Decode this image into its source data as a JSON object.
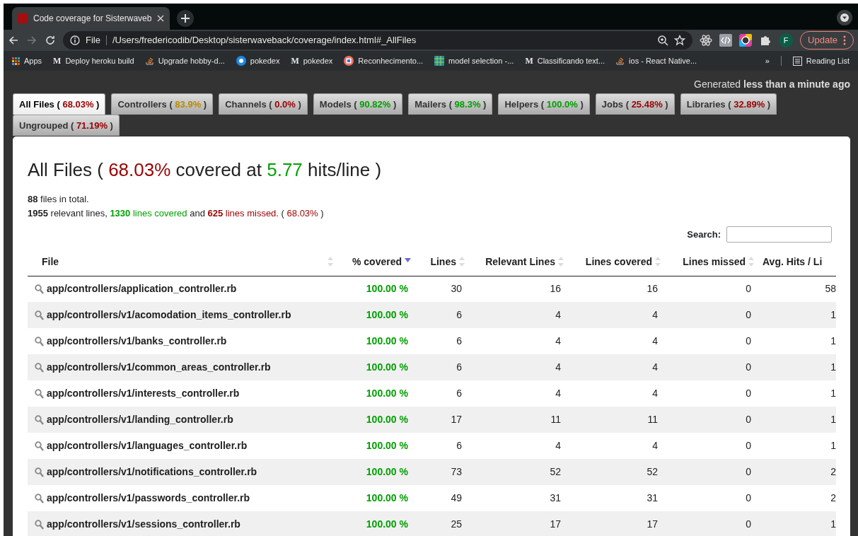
{
  "browser": {
    "tab_title": "Code coverage for Sisterwaveb",
    "url_scheme": "File",
    "url": "/Users/fredericodib/Desktop/sisterwaveback/coverage/index.html#_AllFiles",
    "profile": "F",
    "update_button": "Update",
    "bookmarks": [
      {
        "label": "Apps",
        "kind": "apps"
      },
      {
        "label": "Deploy heroku build",
        "kind": "letter",
        "logo": "M"
      },
      {
        "label": "Upgrade hobby-d...",
        "kind": "stack"
      },
      {
        "label": "pokedex",
        "kind": "circle"
      },
      {
        "label": "pokedex",
        "kind": "letter",
        "logo": "M"
      },
      {
        "label": "Reconhecimento...",
        "kind": "badge"
      },
      {
        "label": "model selection -...",
        "kind": "grid"
      },
      {
        "label": "Classificando text...",
        "kind": "letter",
        "logo": "M"
      },
      {
        "label": "ios - React Native...",
        "kind": "stack"
      }
    ],
    "more_bookmarks": "»",
    "reading_list": "Reading List"
  },
  "generated": {
    "prefix": "Generated",
    "value": "less than a minute ago"
  },
  "groups": [
    {
      "name": "All Files (",
      "percent": "68.03%",
      "close": ")",
      "color": "#990000",
      "selected": true
    },
    {
      "name": "Controllers (",
      "percent": "83.9%",
      "close": ")",
      "color": "#b88a00",
      "selected": false
    },
    {
      "name": "Channels (",
      "percent": "0.0%",
      "close": ")",
      "color": "#990000",
      "selected": false
    },
    {
      "name": "Models (",
      "percent": "90.82%",
      "close": ")",
      "color": "#00a000",
      "selected": false
    },
    {
      "name": "Mailers (",
      "percent": "98.3%",
      "close": ")",
      "color": "#00a000",
      "selected": false
    },
    {
      "name": "Helpers (",
      "percent": "100.0%",
      "close": ")",
      "color": "#00a000",
      "selected": false
    },
    {
      "name": "Jobs (",
      "percent": "25.48%",
      "close": ")",
      "color": "#990000",
      "selected": false
    },
    {
      "name": "Libraries (",
      "percent": "32.89%",
      "close": ")",
      "color": "#990000",
      "selected": false
    },
    {
      "name": "Ungrouped (",
      "percent": "71.19%",
      "close": ")",
      "color": "#990000",
      "selected": false
    }
  ],
  "heading": [
    {
      "text": "All Files (",
      "bold": false
    },
    {
      "text": "68.03%",
      "color": "#990000",
      "bold": false
    },
    {
      "text": "covered at",
      "bold": false
    },
    {
      "text": "5.77",
      "color": "#00a000",
      "bold": false
    },
    {
      "text": "hits/line )",
      "bold": false
    }
  ],
  "files_total": "**88** files in total.",
  "summary": [
    {
      "text": "1955",
      "bold": true
    },
    {
      "text": "relevant lines,",
      "bold": false
    },
    {
      "text": "1330",
      "color": "#00a000",
      "bold": true
    },
    {
      "text": "lines covered",
      "color": "#00a000",
      "bold": false
    },
    {
      "text": "and",
      "bold": false
    },
    {
      "text": "625",
      "color": "#990000",
      "bold": true
    },
    {
      "text": "lines missed.",
      "color": "#990000",
      "bold": false
    },
    {
      "text": "(",
      "bold": false
    },
    {
      "text": "68.03%",
      "color": "#990000",
      "bold": false
    },
    {
      "text": ")",
      "bold": false
    }
  ],
  "search_label": "Search:",
  "table": {
    "columns": [
      {
        "label": "File",
        "kind": "sortable",
        "sorted": false
      },
      {
        "label": "% covered",
        "kind": "sortable",
        "sorted": true
      },
      {
        "label": "Lines",
        "kind": "sortable",
        "sorted": false
      },
      {
        "label": "Relevant Lines",
        "kind": "sortable",
        "sorted": false
      },
      {
        "label": "Lines covered",
        "kind": "sortable",
        "sorted": false
      },
      {
        "label": "Lines missed",
        "kind": "sortable",
        "sorted": false
      },
      {
        "label": "Avg. Hits / Li",
        "kind": "plain"
      }
    ],
    "rows": [
      [
        "app/controllers/application_controller.rb",
        "100.00 %",
        "30",
        "16",
        "16",
        "0",
        "58"
      ],
      [
        "app/controllers/v1/acomodation_items_controller.rb",
        "100.00 %",
        "6",
        "4",
        "4",
        "0",
        "1"
      ],
      [
        "app/controllers/v1/banks_controller.rb",
        "100.00 %",
        "6",
        "4",
        "4",
        "0",
        "1"
      ],
      [
        "app/controllers/v1/common_areas_controller.rb",
        "100.00 %",
        "6",
        "4",
        "4",
        "0",
        "1"
      ],
      [
        "app/controllers/v1/interests_controller.rb",
        "100.00 %",
        "6",
        "4",
        "4",
        "0",
        "1"
      ],
      [
        "app/controllers/v1/landing_controller.rb",
        "100.00 %",
        "17",
        "11",
        "11",
        "0",
        "1"
      ],
      [
        "app/controllers/v1/languages_controller.rb",
        "100.00 %",
        "6",
        "4",
        "4",
        "0",
        "1"
      ],
      [
        "app/controllers/v1/notifications_controller.rb",
        "100.00 %",
        "73",
        "52",
        "52",
        "0",
        "2"
      ],
      [
        "app/controllers/v1/passwords_controller.rb",
        "100.00 %",
        "49",
        "31",
        "31",
        "0",
        "2"
      ],
      [
        "app/controllers/v1/sessions_controller.rb",
        "100.00 %",
        "25",
        "17",
        "17",
        "0",
        "1"
      ]
    ]
  }
}
